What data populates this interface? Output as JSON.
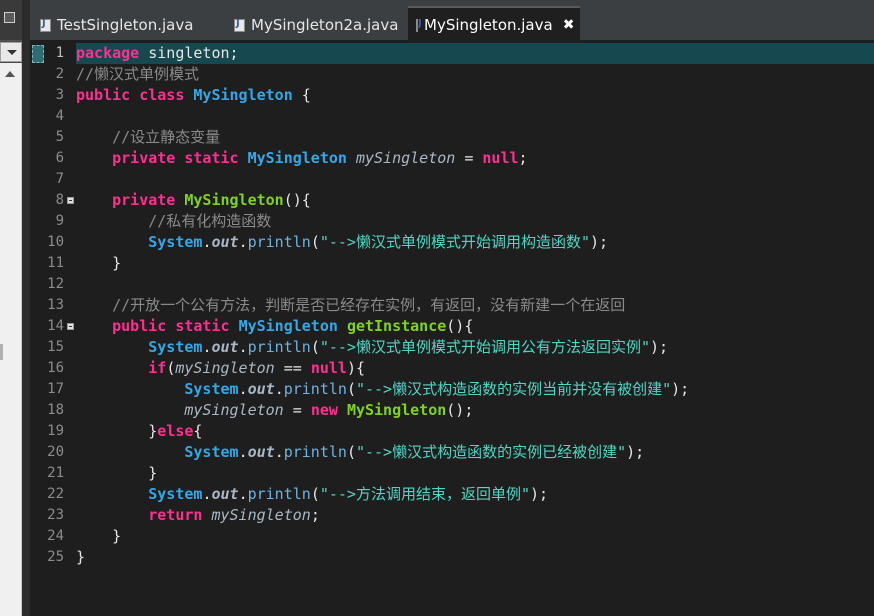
{
  "tabs": [
    {
      "label": "TestSingleton.java",
      "active": false
    },
    {
      "label": "MySingleton2a.java",
      "active": false
    },
    {
      "label": "MySingleton.java",
      "active": true,
      "close": "✖"
    }
  ],
  "colors": {
    "keyword": "#ff2f92",
    "class": "#33a8e6",
    "method": "#7ed321",
    "string": "#4fd6c4",
    "comment": "#8a8a8a",
    "current_line": "#164850"
  },
  "editor": {
    "current_line": 1,
    "lines": [
      {
        "num": "1",
        "tokens": [
          {
            "t": "package",
            "c": "kw"
          },
          {
            "t": " singleton;",
            "c": "ident"
          }
        ]
      },
      {
        "num": "2",
        "tokens": [
          {
            "t": "//懒汉式单例模式",
            "c": "cmt"
          }
        ]
      },
      {
        "num": "3",
        "tokens": [
          {
            "t": "public",
            "c": "kw"
          },
          {
            "t": " ",
            "c": "ident"
          },
          {
            "t": "class",
            "c": "kw"
          },
          {
            "t": " ",
            "c": "ident"
          },
          {
            "t": "MySingleton",
            "c": "cls"
          },
          {
            "t": " {",
            "c": "ident"
          }
        ]
      },
      {
        "num": "4",
        "tokens": []
      },
      {
        "num": "5",
        "tokens": [
          {
            "t": "    //设立静态变量",
            "c": "cmt"
          }
        ]
      },
      {
        "num": "6",
        "tokens": [
          {
            "t": "    ",
            "c": "ident"
          },
          {
            "t": "private",
            "c": "kw"
          },
          {
            "t": " ",
            "c": "ident"
          },
          {
            "t": "static",
            "c": "kw"
          },
          {
            "t": " ",
            "c": "ident"
          },
          {
            "t": "MySingleton",
            "c": "cls"
          },
          {
            "t": " ",
            "c": "ident"
          },
          {
            "t": "mySingleton",
            "c": "var"
          },
          {
            "t": " = ",
            "c": "ident"
          },
          {
            "t": "null",
            "c": "kw"
          },
          {
            "t": ";",
            "c": "ident"
          }
        ]
      },
      {
        "num": "7",
        "tokens": []
      },
      {
        "num": "8",
        "fold": true,
        "tokens": [
          {
            "t": "    ",
            "c": "ident"
          },
          {
            "t": "private",
            "c": "kw"
          },
          {
            "t": " ",
            "c": "ident"
          },
          {
            "t": "MySingleton",
            "c": "mth"
          },
          {
            "t": "(){",
            "c": "ident"
          }
        ]
      },
      {
        "num": "9",
        "tokens": [
          {
            "t": "        //私有化构造函数",
            "c": "cmt"
          }
        ]
      },
      {
        "num": "10",
        "tokens": [
          {
            "t": "        ",
            "c": "ident"
          },
          {
            "t": "System",
            "c": "sys"
          },
          {
            "t": ".",
            "c": "ident"
          },
          {
            "t": "out",
            "c": "sysfld"
          },
          {
            "t": ".",
            "c": "ident"
          },
          {
            "t": "println",
            "c": "call"
          },
          {
            "t": "(",
            "c": "ident"
          },
          {
            "t": "\"-->懒汉式单例模式开始调用构造函数\"",
            "c": "str"
          },
          {
            "t": ");",
            "c": "ident"
          }
        ]
      },
      {
        "num": "11",
        "tokens": [
          {
            "t": "    }",
            "c": "ident"
          }
        ]
      },
      {
        "num": "12",
        "tokens": []
      },
      {
        "num": "13",
        "tokens": [
          {
            "t": "    //开放一个公有方法，判断是否已经存在实例，有返回，没有新建一个在返回",
            "c": "cmt"
          }
        ]
      },
      {
        "num": "14",
        "fold": true,
        "tokens": [
          {
            "t": "    ",
            "c": "ident"
          },
          {
            "t": "public",
            "c": "kw"
          },
          {
            "t": " ",
            "c": "ident"
          },
          {
            "t": "static",
            "c": "kw"
          },
          {
            "t": " ",
            "c": "ident"
          },
          {
            "t": "MySingleton",
            "c": "cls"
          },
          {
            "t": " ",
            "c": "ident"
          },
          {
            "t": "getInstance",
            "c": "mth"
          },
          {
            "t": "(){",
            "c": "ident"
          }
        ]
      },
      {
        "num": "15",
        "tokens": [
          {
            "t": "        ",
            "c": "ident"
          },
          {
            "t": "System",
            "c": "sys"
          },
          {
            "t": ".",
            "c": "ident"
          },
          {
            "t": "out",
            "c": "sysfld"
          },
          {
            "t": ".",
            "c": "ident"
          },
          {
            "t": "println",
            "c": "call"
          },
          {
            "t": "(",
            "c": "ident"
          },
          {
            "t": "\"-->懒汉式单例模式开始调用公有方法返回实例\"",
            "c": "str"
          },
          {
            "t": ");",
            "c": "ident"
          }
        ]
      },
      {
        "num": "16",
        "tokens": [
          {
            "t": "        ",
            "c": "ident"
          },
          {
            "t": "if",
            "c": "kw"
          },
          {
            "t": "(",
            "c": "ident"
          },
          {
            "t": "mySingleton",
            "c": "var"
          },
          {
            "t": " == ",
            "c": "ident"
          },
          {
            "t": "null",
            "c": "kw"
          },
          {
            "t": "){",
            "c": "ident"
          }
        ]
      },
      {
        "num": "17",
        "tokens": [
          {
            "t": "            ",
            "c": "ident"
          },
          {
            "t": "System",
            "c": "sys"
          },
          {
            "t": ".",
            "c": "ident"
          },
          {
            "t": "out",
            "c": "sysfld"
          },
          {
            "t": ".",
            "c": "ident"
          },
          {
            "t": "println",
            "c": "call"
          },
          {
            "t": "(",
            "c": "ident"
          },
          {
            "t": "\"-->懒汉式构造函数的实例当前并没有被创建\"",
            "c": "str"
          },
          {
            "t": ");",
            "c": "ident"
          }
        ]
      },
      {
        "num": "18",
        "tokens": [
          {
            "t": "            ",
            "c": "ident"
          },
          {
            "t": "mySingleton",
            "c": "var"
          },
          {
            "t": " = ",
            "c": "ident"
          },
          {
            "t": "new",
            "c": "kw"
          },
          {
            "t": " ",
            "c": "ident"
          },
          {
            "t": "MySingleton",
            "c": "mth"
          },
          {
            "t": "();",
            "c": "ident"
          }
        ]
      },
      {
        "num": "19",
        "tokens": [
          {
            "t": "        }",
            "c": "ident"
          },
          {
            "t": "else",
            "c": "kw"
          },
          {
            "t": "{",
            "c": "ident"
          }
        ]
      },
      {
        "num": "20",
        "tokens": [
          {
            "t": "            ",
            "c": "ident"
          },
          {
            "t": "System",
            "c": "sys"
          },
          {
            "t": ".",
            "c": "ident"
          },
          {
            "t": "out",
            "c": "sysfld"
          },
          {
            "t": ".",
            "c": "ident"
          },
          {
            "t": "println",
            "c": "call"
          },
          {
            "t": "(",
            "c": "ident"
          },
          {
            "t": "\"-->懒汉式构造函数的实例已经被创建\"",
            "c": "str"
          },
          {
            "t": ");",
            "c": "ident"
          }
        ]
      },
      {
        "num": "21",
        "tokens": [
          {
            "t": "        }",
            "c": "ident"
          }
        ]
      },
      {
        "num": "22",
        "tokens": [
          {
            "t": "        ",
            "c": "ident"
          },
          {
            "t": "System",
            "c": "sys"
          },
          {
            "t": ".",
            "c": "ident"
          },
          {
            "t": "out",
            "c": "sysfld"
          },
          {
            "t": ".",
            "c": "ident"
          },
          {
            "t": "println",
            "c": "call"
          },
          {
            "t": "(",
            "c": "ident"
          },
          {
            "t": "\"-->方法调用结束，返回单例\"",
            "c": "str"
          },
          {
            "t": ");",
            "c": "ident"
          }
        ]
      },
      {
        "num": "23",
        "tokens": [
          {
            "t": "        ",
            "c": "ident"
          },
          {
            "t": "return",
            "c": "kw"
          },
          {
            "t": " ",
            "c": "ident"
          },
          {
            "t": "mySingleton",
            "c": "var"
          },
          {
            "t": ";",
            "c": "ident"
          }
        ]
      },
      {
        "num": "24",
        "tokens": [
          {
            "t": "    }",
            "c": "ident"
          }
        ]
      },
      {
        "num": "25",
        "tokens": [
          {
            "t": "}",
            "c": "ident"
          }
        ]
      }
    ]
  }
}
